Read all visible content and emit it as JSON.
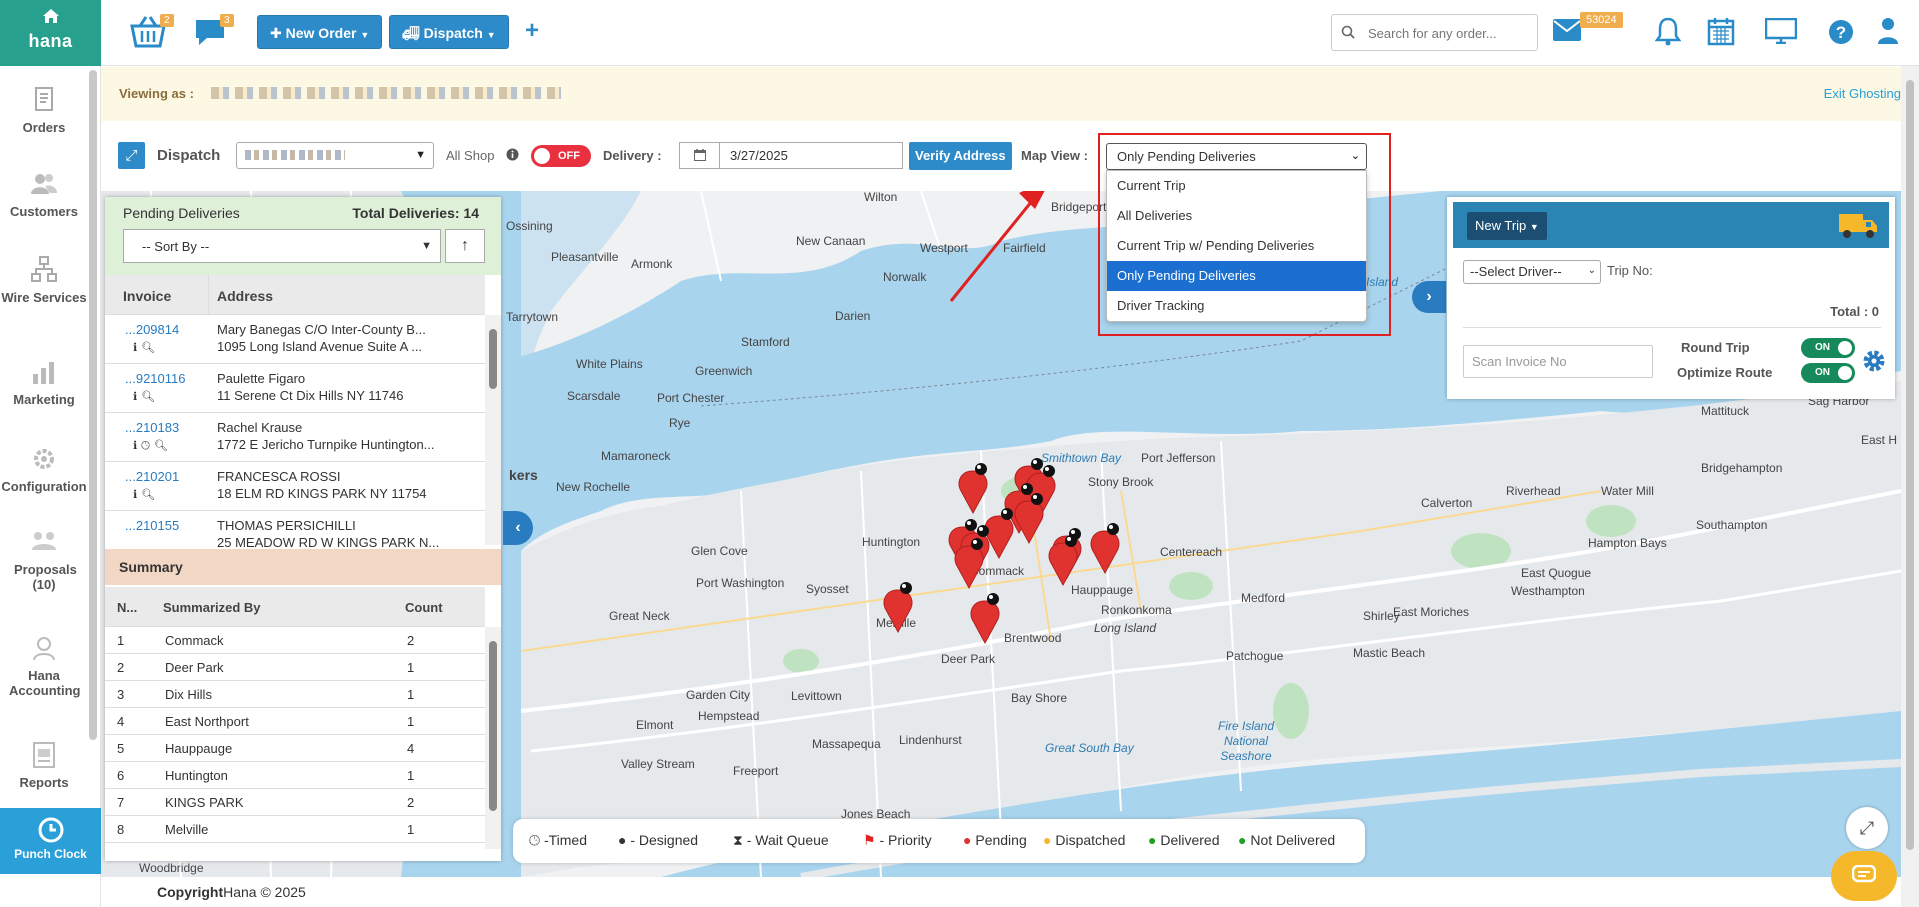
{
  "brand": {
    "name": "hana"
  },
  "top": {
    "cart_badge": "2",
    "chat_badge": "3",
    "new_order_label": "New Order",
    "dispatch_label": "Dispatch",
    "plus_label": "+",
    "search_placeholder": "Search for any order...",
    "mail_badge": "53024"
  },
  "sidebar": {
    "items": [
      {
        "label": "Orders"
      },
      {
        "label": "Customers"
      },
      {
        "label": "Wire Services"
      },
      {
        "label": "Marketing"
      },
      {
        "label": "Configuration"
      },
      {
        "label": "Proposals (10)"
      },
      {
        "label": "Hana Accounting"
      },
      {
        "label": "Reports"
      }
    ],
    "punch_label": "Punch Clock"
  },
  "ghost": {
    "viewing_as": "Viewing as :",
    "exit": "Exit Ghosting"
  },
  "dispatch_bar": {
    "title": "Dispatch",
    "all_shop": "All Shop",
    "toggle": "OFF",
    "delivery_label": "Delivery :",
    "date": "3/27/2025",
    "verify": "Verify Address",
    "map_view_label": "Map View :",
    "map_view_selected": "Only Pending Deliveries",
    "map_view_options": [
      "Current Trip",
      "All Deliveries",
      "Current Trip w/ Pending Deliveries",
      "Only Pending Deliveries",
      "Driver Tracking"
    ]
  },
  "pending": {
    "title": "Pending Deliveries",
    "total": "Total Deliveries: 14",
    "sort_placeholder": "-- Sort By --",
    "col_invoice": "Invoice",
    "col_address": "Address",
    "rows": [
      {
        "invoice": "...209814",
        "name": "Mary Banegas C/O Inter-County B...",
        "address": "1095 Long Island Avenue Suite A ..."
      },
      {
        "invoice": "...9210116",
        "name": "Paulette Figaro",
        "address": "11 Serene Ct Dix Hills NY 11746"
      },
      {
        "invoice": "...210183",
        "name": "Rachel Krause",
        "address": "1772 E Jericho Turnpike Huntington..."
      },
      {
        "invoice": "...210201",
        "name": "FRANCESCA ROSSI",
        "address": "18 ELM RD KINGS PARK NY 11754"
      },
      {
        "invoice": "...210155",
        "name": "THOMAS PERSICHILLI",
        "address": "25 MEADOW RD W KINGS PARK N..."
      }
    ]
  },
  "summary": {
    "title": "Summary",
    "col_n": "N...",
    "col_by": "Summarized By",
    "col_count": "Count",
    "rows": [
      {
        "n": "1",
        "by": "Commack",
        "count": "2"
      },
      {
        "n": "2",
        "by": "Deer Park",
        "count": "1"
      },
      {
        "n": "3",
        "by": "Dix Hills",
        "count": "1"
      },
      {
        "n": "4",
        "by": "East Northport",
        "count": "1"
      },
      {
        "n": "5",
        "by": "Hauppauge",
        "count": "4"
      },
      {
        "n": "6",
        "by": "Huntington",
        "count": "1"
      },
      {
        "n": "7",
        "by": "KINGS PARK",
        "count": "2"
      },
      {
        "n": "8",
        "by": "Melville",
        "count": "1"
      }
    ]
  },
  "trip": {
    "new_trip": "New Trip",
    "driver_placeholder": "--Select Driver--",
    "trip_no": "Trip No:",
    "total": "Total : 0",
    "round_trip": "Round Trip",
    "optimize": "Optimize Route",
    "on": "ON",
    "scan_placeholder": "Scan Invoice No"
  },
  "legend": {
    "timed": "-Timed",
    "designed": "- Designed",
    "wait": "- Wait Queue",
    "priority": "- Priority",
    "pending": "Pending",
    "dispatched": "Dispatched",
    "delivered": "Delivered",
    "not_delivered": "Not Delivered"
  },
  "map_places": [
    "Wilton",
    "Ossining",
    "Bridgeport",
    "Pleasantville",
    "Armonk",
    "New Canaan",
    "Westport",
    "Fairfield",
    "Norwalk",
    "Tarrytown",
    "Darien",
    "Stamford",
    "White Plains",
    "Greenwich",
    "Scarsdale",
    "Port Chester",
    "Rye",
    "Mamaroneck",
    "New Rochelle",
    "Huntington",
    "Port Jefferson",
    "Stony Brook",
    "Centereach",
    "Commack",
    "Hauppauge",
    "Ronkonkoma",
    "Melville",
    "Brentwood",
    "Deer Park",
    "Long Island",
    "Bay Shore",
    "Medford",
    "Patchogue",
    "Shirley",
    "Mastic Beach",
    "Calverton",
    "Riverhead",
    "Water Mill",
    "Bridgehampton",
    "Southampton",
    "Hampton Bays",
    "East Quogue",
    "Westhampton",
    "East Moriches",
    "Mattituck",
    "Sag Harbor",
    "East H",
    "Glen Cove",
    "Port Washington",
    "Syosset",
    "Great Neck",
    "Garden City",
    "Hempstead",
    "Levittown",
    "Elmont",
    "Massapequa",
    "Lindenhurst",
    "Valley Stream",
    "Freeport",
    "Jones Beach",
    "Fire Island National Seashore",
    "Great South Bay",
    "Woodbridge",
    "kers",
    "Smithtown Bay",
    "Island"
  ],
  "footer": {
    "copyright": "Copyright",
    "brand": "Hana © 2025"
  }
}
